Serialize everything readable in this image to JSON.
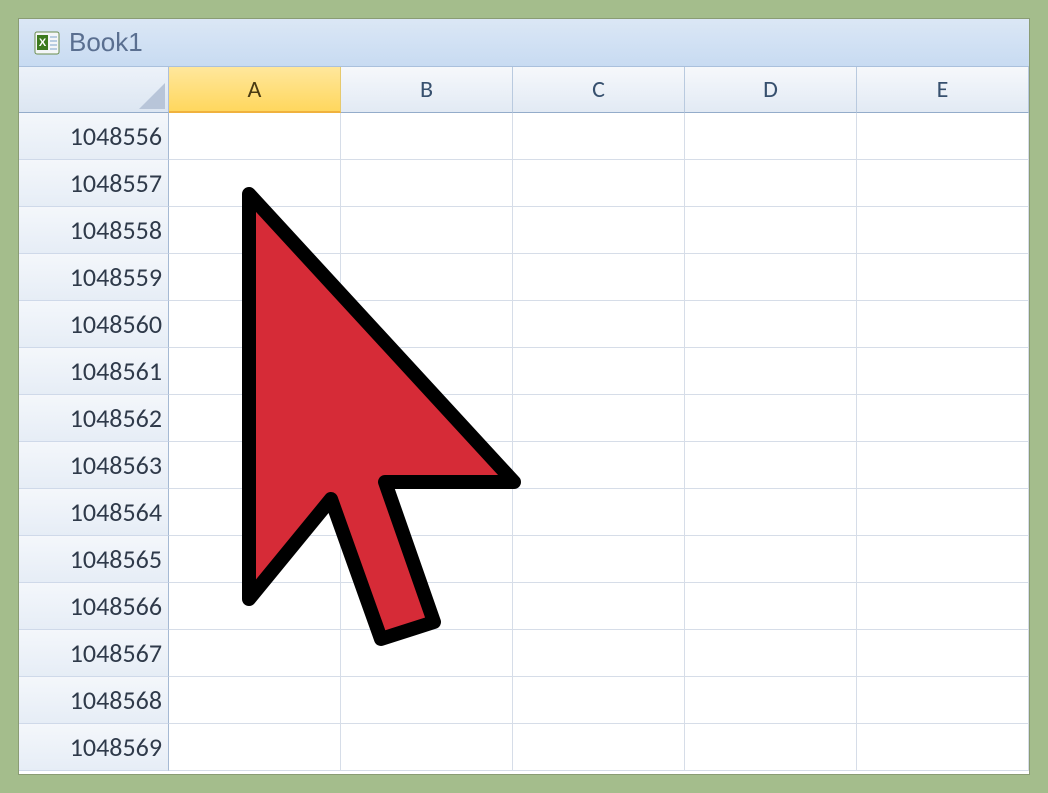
{
  "title": "Book1",
  "columns": [
    "A",
    "B",
    "C",
    "D",
    "E"
  ],
  "selected_column_index": 0,
  "row_start": 1048556,
  "row_end": 1048569,
  "cursor": {
    "color": "#d62b37",
    "stroke": "#000000"
  }
}
